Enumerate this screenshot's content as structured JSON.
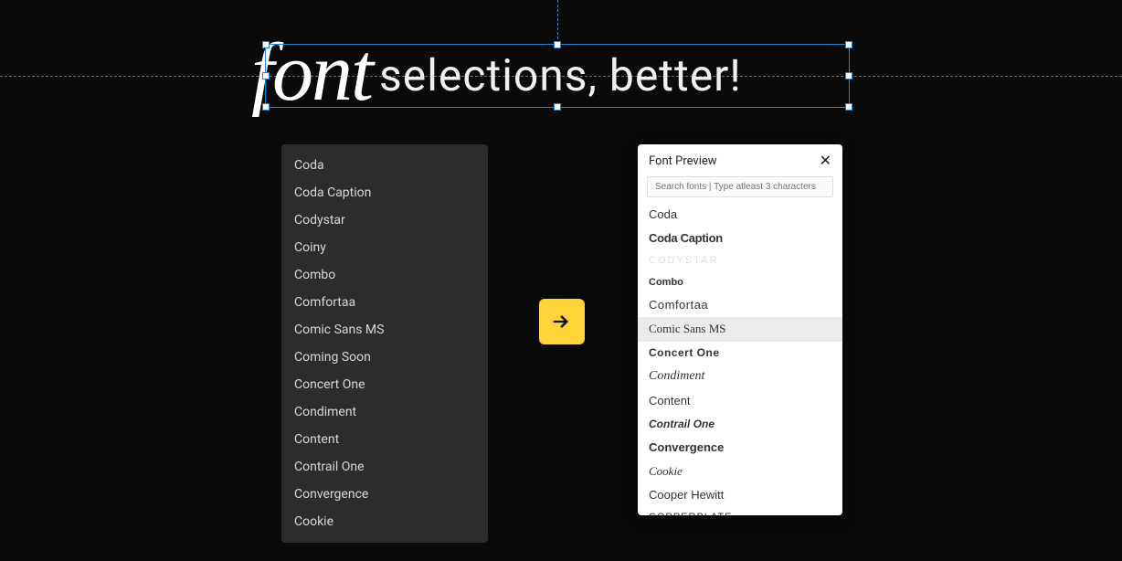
{
  "heading": {
    "script_word": "font",
    "rest": "selections, better!"
  },
  "dark_list": {
    "items": [
      "Coda",
      "Coda Caption",
      "Codystar",
      "Coiny",
      "Combo",
      "Comfortaa",
      "Comic Sans MS",
      "Coming Soon",
      "Concert One",
      "Condiment",
      "Content",
      "Contrail One",
      "Convergence",
      "Cookie"
    ]
  },
  "preview_panel": {
    "title": "Font Preview",
    "close_label": "✕",
    "search_placeholder": "Search fonts | Type atleast 3 characters",
    "items": [
      {
        "label": "Coda",
        "style": "f-coda",
        "selected": false
      },
      {
        "label": "Coda Caption",
        "style": "f-coda-caption",
        "selected": false
      },
      {
        "label": "CODYSTAR",
        "style": "f-codystar",
        "selected": false
      },
      {
        "label": "Combo",
        "style": "f-combo",
        "selected": false
      },
      {
        "label": "Comfortaa",
        "style": "f-comfortaa",
        "selected": false
      },
      {
        "label": "Comic Sans MS",
        "style": "f-comic",
        "selected": true
      },
      {
        "label": "Concert One",
        "style": "f-concert",
        "selected": false
      },
      {
        "label": "Condiment",
        "style": "f-condiment",
        "selected": false
      },
      {
        "label": "Content",
        "style": "f-content",
        "selected": false
      },
      {
        "label": "Contrail One",
        "style": "f-contrail",
        "selected": false
      },
      {
        "label": "Convergence",
        "style": "f-convergence",
        "selected": false
      },
      {
        "label": "Cookie",
        "style": "f-cookie",
        "selected": false
      },
      {
        "label": "Cooper Hewitt",
        "style": "f-cooper",
        "selected": false
      },
      {
        "label": "Copperplate",
        "style": "f-copperplate",
        "selected": false
      }
    ]
  },
  "colors": {
    "background": "#0a0a0a",
    "guide": "#1e88d4",
    "arrow_bg": "#ffd43b"
  }
}
